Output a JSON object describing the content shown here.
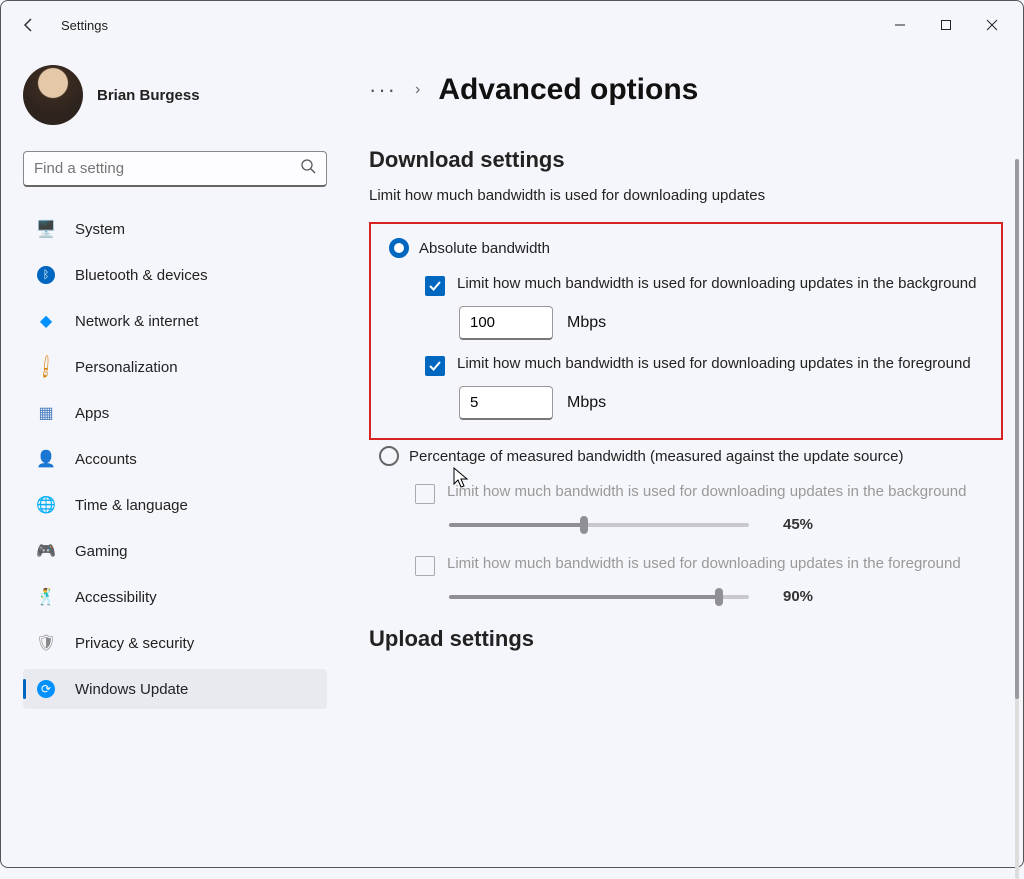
{
  "app_title": "Settings",
  "user": {
    "name": "Brian Burgess"
  },
  "search": {
    "placeholder": "Find a setting"
  },
  "nav": [
    {
      "label": "System"
    },
    {
      "label": "Bluetooth & devices"
    },
    {
      "label": "Network & internet"
    },
    {
      "label": "Personalization"
    },
    {
      "label": "Apps"
    },
    {
      "label": "Accounts"
    },
    {
      "label": "Time & language"
    },
    {
      "label": "Gaming"
    },
    {
      "label": "Accessibility"
    },
    {
      "label": "Privacy & security"
    },
    {
      "label": "Windows Update"
    }
  ],
  "page": {
    "title": "Advanced options",
    "download_section": {
      "heading": "Download settings",
      "desc": "Limit how much bandwidth is used for downloading updates",
      "radio_absolute": "Absolute bandwidth",
      "radio_percent": "Percentage of measured bandwidth (measured against the update source)",
      "bg_label": "Limit how much bandwidth is used for downloading updates in the background",
      "fg_label": "Limit how much bandwidth is used for downloading updates in the foreground",
      "bg_value": "100",
      "fg_value": "5",
      "unit": "Mbps",
      "pct_bg_value": "45%",
      "pct_fg_value": "90%"
    },
    "upload_heading": "Upload settings"
  }
}
